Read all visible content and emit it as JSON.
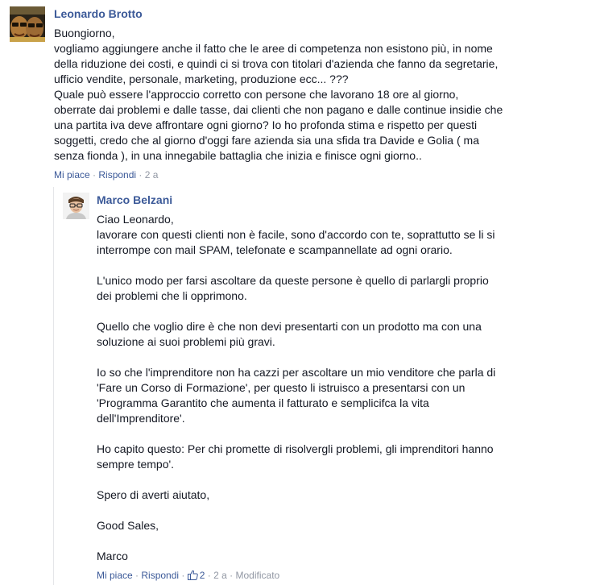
{
  "comments": [
    {
      "author": "Leonardo Brotto",
      "paragraphs": [
        "Buongiorno,",
        "vogliamo aggiungere anche il fatto che le aree di competenza non esistono più, in nome",
        "della riduzione dei costi, e quindi ci si trova con titolari d'azienda che fanno da segretarie,",
        "ufficio vendite, personale, marketing, produzione ecc... ???",
        "Quale può essere l'approccio corretto con persone che lavorano 18 ore al giorno,",
        "oberrate dai problemi e dalle tasse, dai clienti che non pagano e dalle continue insidie che",
        "una partita iva deve affrontare ogni giorno? Io ho profonda stima e rispetto per questi",
        "soggetti, credo che al giorno d'oggi fare azienda sia una sfida tra Davide e Golia ( ma",
        "senza fionda ), in una innegabile battaglia che inizia e finisce ogni giorno.."
      ],
      "actions": {
        "like": "Mi piace",
        "reply": "Rispondi",
        "time": "2 a"
      }
    },
    {
      "author": "Marco Belzani",
      "paragraphs": [
        [
          "Ciao Leonardo,",
          "lavorare con questi clienti non è facile, sono d'accordo con te, soprattutto se li si",
          "interrompe con mail SPAM, telefonate e scampannellate ad ogni orario."
        ],
        [
          "L'unico modo per farsi ascoltare da queste persone è quello di parlargli proprio",
          "dei problemi che li opprimono."
        ],
        [
          "Quello che voglio dire è che non devi presentarti con un prodotto ma con una",
          "soluzione ai suoi problemi più gravi."
        ],
        [
          "Io so che l'imprenditore non ha cazzi per ascoltare un mio venditore che parla di",
          "'Fare un Corso di Formazione', per questo li istruisco a presentarsi con un",
          "'Programma Garantito che aumenta il fatturato e semplicifca la vita",
          "dell'Imprenditore'."
        ],
        [
          "Ho capito questo: Per chi promette di risolvergli problemi, gli imprenditori hanno",
          "sempre tempo'."
        ],
        [
          "Spero di averti aiutato,"
        ],
        [
          "Good Sales,"
        ],
        [
          "Marco"
        ]
      ],
      "actions": {
        "like": "Mi piace",
        "reply": "Rispondi",
        "likes_count": "2",
        "time": "2 a",
        "edited": "Modificato"
      }
    }
  ],
  "colors": {
    "link": "#3b5998",
    "meta": "#9197a3",
    "text": "#141823"
  },
  "icons": {
    "like": "thumbs-up-icon"
  }
}
